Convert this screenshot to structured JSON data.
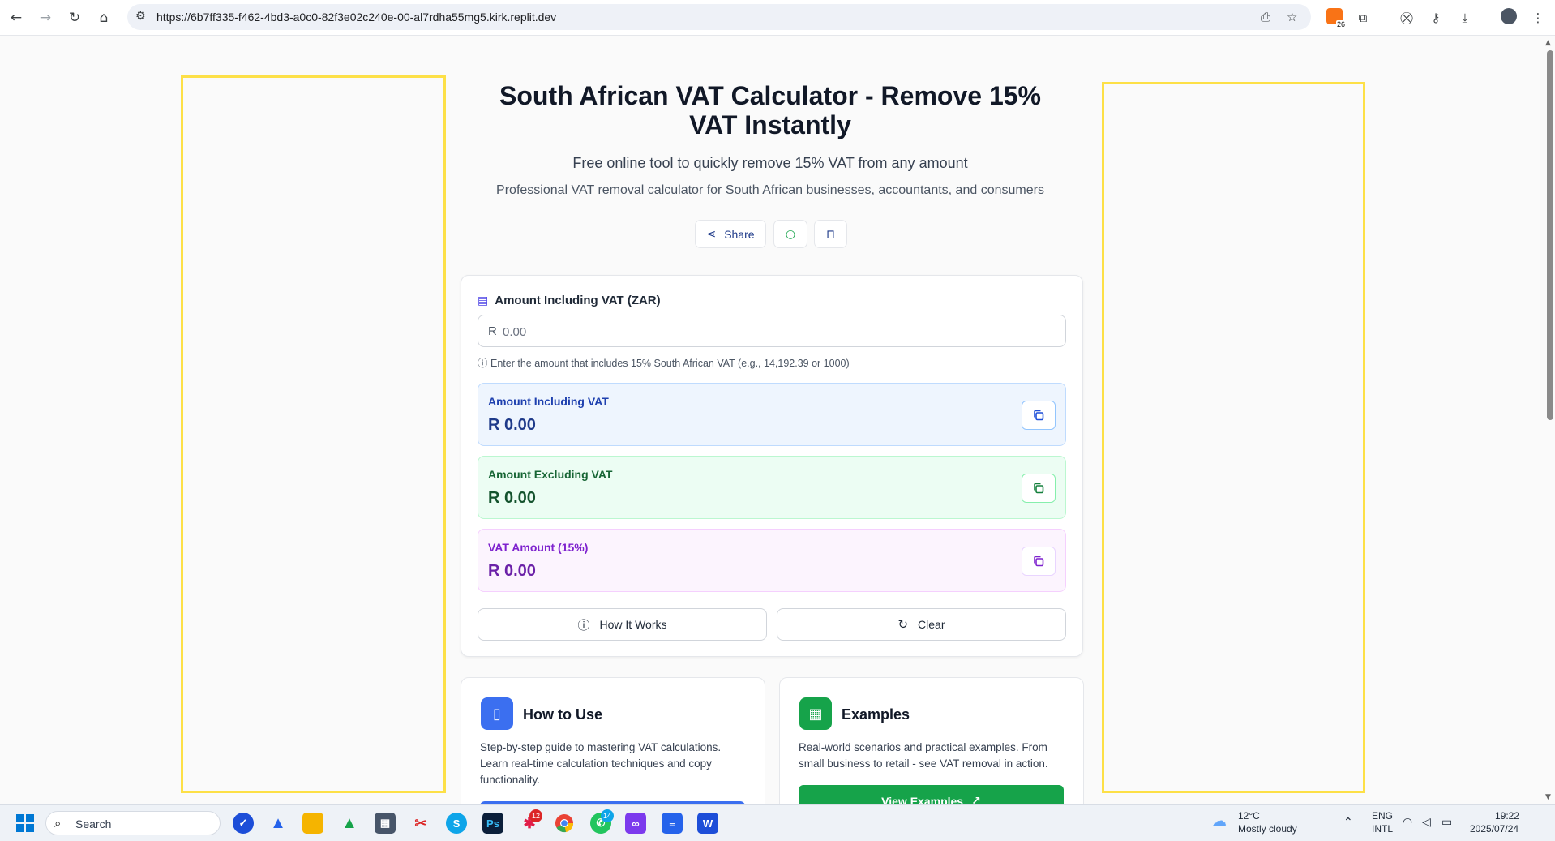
{
  "browser": {
    "url": "https://6b7ff335-f462-4bd3-a0c0-82f3e02c240e-00-al7rdha55mg5.kirk.replit.dev",
    "extension_badge": "26"
  },
  "header": {
    "title_line1": "South African VAT Calculator - Remove 15%",
    "title_line2": "VAT Instantly",
    "subtitle": "Free online tool to quickly remove 15% VAT from any amount",
    "description": "Professional VAT removal calculator for South African businesses, accountants, and consumers",
    "share_label": "Share"
  },
  "calculator": {
    "input_label": "Amount Including VAT (ZAR)",
    "currency_symbol": "R",
    "input_placeholder": "0.00",
    "input_value": "",
    "hint": "Enter the amount that includes 15% South African VAT (e.g., 14,192.39 or 1000)",
    "results": [
      {
        "label": "Amount Including VAT",
        "value": "R 0.00"
      },
      {
        "label": "Amount Excluding VAT",
        "value": "R 0.00"
      },
      {
        "label": "VAT Amount (15%)",
        "value": "R 0.00"
      }
    ],
    "how_it_works_label": "How It Works",
    "clear_label": "Clear"
  },
  "cards": {
    "how_to_use": {
      "title": "How to Use",
      "description": "Step-by-step guide to mastering VAT calculations. Learn real-time calculation techniques and copy functionality."
    },
    "examples": {
      "title": "Examples",
      "description": "Real-world scenarios and practical examples. From small business to retail - see VAT removal in action.",
      "button_label": "View Examples"
    }
  },
  "taskbar": {
    "search_label": "Search",
    "slack_badge": "12",
    "whatsapp_badge": "14",
    "weather_temp": "12°C",
    "weather_desc": "Mostly cloudy",
    "lang_line1": "ENG",
    "lang_line2": "INTL",
    "time": "19:22",
    "date": "2025/07/24"
  },
  "colors": {
    "ad_outline": "#fde047",
    "how_to_use_accent": "#3b6ff0",
    "examples_accent": "#16a34a"
  }
}
